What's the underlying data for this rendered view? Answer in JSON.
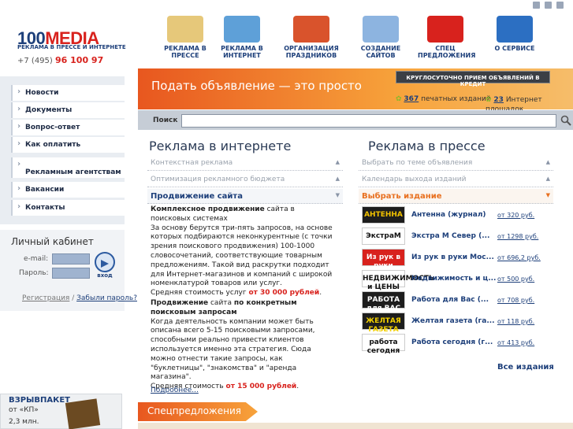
{
  "header": {
    "logo_main": "100",
    "logo_accent": "MEDIA",
    "logo_sub": "РЕКЛАМА В ПРЕССЕ И ИНТЕРНЕТЕ",
    "phone_prefix": "+7 (495)",
    "phone_number": "96 100 97",
    "nav": [
      {
        "label": "РЕКЛАМА В ПРЕССЕ",
        "icon": "newspaper-icon",
        "color": "#e6c87a"
      },
      {
        "label": "РЕКЛАМА В ИНТЕРНЕТ",
        "icon": "globe-icon",
        "color": "#5ea0d8"
      },
      {
        "label": "ОРГАНИЗАЦИЯ ПРАЗДНИКОВ",
        "icon": "fireworks-icon",
        "color": "#d9532c"
      },
      {
        "label": "СОЗДАНИЕ САЙТОВ",
        "icon": "laptop-icon",
        "color": "#8db4e0"
      },
      {
        "label": "СПЕЦ ПРЕДЛОЖЕНИЯ",
        "icon": "gift-icon",
        "color": "#d8221d"
      },
      {
        "label": "О СЕРВИСЕ",
        "icon": "info-icon",
        "color": "#2c6fc2"
      }
    ]
  },
  "sidebar": {
    "items": [
      "Новости",
      "Документы",
      "Вопрос-ответ",
      "Как оплатить",
      "Рекламным агентствам",
      "Вакансии",
      "Контакты"
    ]
  },
  "cabinet": {
    "title": "Личный кабинет",
    "email_label": "e-mail:",
    "password_label": "Пароль:",
    "enter_label": "вход",
    "register": "Регистрация",
    "forgot": "Забыли пароль?"
  },
  "banner": {
    "line1": "ВЗРЫВПАКЕТ",
    "line2": "от «КП»",
    "line3": "2,3 млн."
  },
  "promo": {
    "title": "Подать объявление — это просто",
    "credit": "КРУГЛОСУТОЧНО ПРИЕМ ОБЪЯВЛЕНИЙ В КРЕДИТ",
    "print_count": "367",
    "print_label": "печатных изданий",
    "web_count": "23",
    "web_label": "Интернет площадок"
  },
  "search": {
    "label": "Поиск",
    "value": ""
  },
  "internet": {
    "title": "Реклама в  интернете",
    "items": [
      "Контекстная реклама",
      "Оптимизация рекламного бюджета",
      "Продвижение сайта"
    ],
    "p1_bold": "Комплексное продвижение",
    "p1_text": " сайта в поисковых системах\nЗа основу берутся три-пять запросов, на основе которых подбираются неконкурентные (с точки зрения поискового продвижения) 100-1000 словосочетаний, соответствующие товарным предложениям. Такой вид раскрутки подходит для Интернет-магазинов и компаний с широкой номенклатурой товаров или услуг.\nСредняя стоимость услуг ",
    "p1_price": "от 30 000 рублей",
    "p2_bold1": "Продвижение",
    "p2_mid": " сайта ",
    "p2_bold2": "по конкретным поисковым запросам",
    "p2_text": "\nКогда деятельность компании может быть описана всего 5-15 поисковыми запросами, способными реально привести клиентов используется именно эта стратегия. Сюда можно отнести такие запросы, как \"буклетницы\", \"знакомства\" и \"аренда магазина\".\nСредняя стоимость ",
    "p2_price": "от 15 000 рублей",
    "more": "Подробнее..."
  },
  "press": {
    "title": "Реклама в прессе",
    "items": [
      "Выбрать по теме объявления",
      "Календарь выхода изданий",
      "Выбрать издание"
    ],
    "publications": [
      {
        "logo": "АНТЕННА",
        "name": "Антенна (журнал)",
        "price": "от 320 руб.",
        "bg": "#1d1d1d",
        "fg": "#f2c200"
      },
      {
        "logo": "ЭкстраМ",
        "name": "Экстра М Север (...",
        "price": "от 1298 руб.",
        "bg": "#ffffff",
        "fg": "#111111"
      },
      {
        "logo": "Из рук в руки",
        "name": "Из рук в руки Мос...",
        "price": "от 696,2 руб.",
        "bg": "#d8221d",
        "fg": "#ffffff"
      },
      {
        "logo": "НЕДВИЖИМОСТЬ и ЦЕНЫ",
        "name": "Недвижимость и ц...",
        "price": "от 500 руб.",
        "bg": "#ffffff",
        "fg": "#111111"
      },
      {
        "logo": "РАБОТА для ВАС",
        "name": "Работа для Вас (...",
        "price": "от 708 руб.",
        "bg": "#1d1d1d",
        "fg": "#ffffff"
      },
      {
        "logo": "ЖЕЛТАЯ ГАЗЕТА",
        "name": "Желтая газета (га...",
        "price": "от 118 руб.",
        "bg": "#1d1d1d",
        "fg": "#f2d000"
      },
      {
        "logo": "работа сегодня",
        "name": "Работа сегодня (г...",
        "price": "от 413 руб.",
        "bg": "#ffffff",
        "fg": "#111111"
      }
    ],
    "all": "Все издания"
  },
  "special": {
    "title": "Спецпредложения"
  }
}
